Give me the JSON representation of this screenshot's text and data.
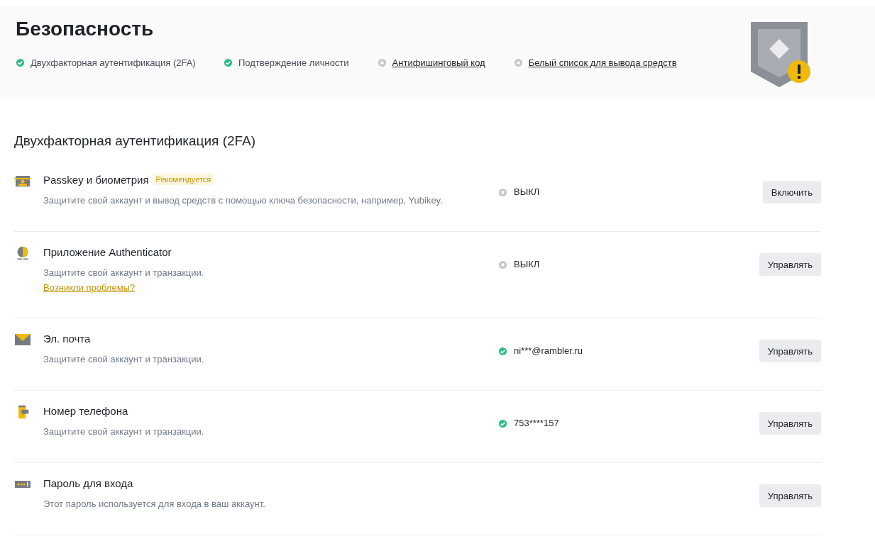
{
  "header": {
    "title": "Безопасность",
    "checks": [
      {
        "label": "Двухфакторная аутентификация (2FA)",
        "done": true
      },
      {
        "label": "Подтверждение личности",
        "done": true
      },
      {
        "label": "Антифишинговый код",
        "done": false
      },
      {
        "label": "Белый список для вывода средств",
        "done": false
      }
    ]
  },
  "section": {
    "heading": "Двухфакторная аутентификация (2FA)",
    "methods": [
      {
        "kind": "passkey",
        "title": "Passkey и биометрия",
        "badge": "Рекомендуется",
        "description": "Защитите свой аккаунт и вывод средств с помощью ключа безопасности, например, Yubikey.",
        "enabled": false,
        "status": "ВЫКЛ",
        "button": "Включить"
      },
      {
        "kind": "authenticator",
        "title": "Приложение Authenticator",
        "description": "Защитите свой аккаунт и транзакции.",
        "link": "Возникли проблемы?",
        "enabled": false,
        "status": "ВЫКЛ",
        "button": "Управлять"
      },
      {
        "kind": "email",
        "title": "Эл. почта",
        "description": "Защитите свой аккаунт и транзакции.",
        "enabled": true,
        "status": "ni***@rambler.ru",
        "button": "Управлять"
      },
      {
        "kind": "phone",
        "title": "Номер телефона",
        "description": "Защитите свой аккаунт и транзакции.",
        "enabled": true,
        "status": "753****157",
        "button": "Управлять"
      },
      {
        "kind": "password",
        "title": "Пароль для входа",
        "description": "Этот пароль используется для входа в ваш аккаунт.",
        "button": "Управлять"
      }
    ]
  }
}
